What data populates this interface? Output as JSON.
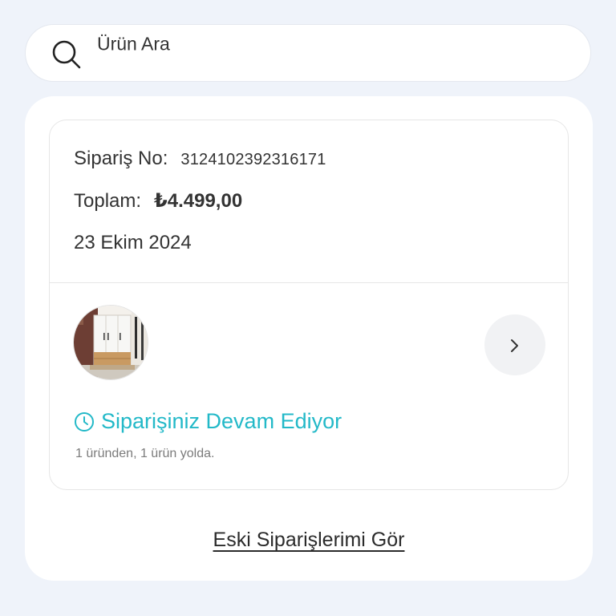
{
  "search": {
    "placeholder": "Ürün Ara",
    "icon": "search-icon"
  },
  "order": {
    "order_no_label": "Sipariş No:",
    "order_no_value": "3124102392316171",
    "total_label": "Toplam:",
    "total_value": "₺4.499,00",
    "date": "23 Ekim 2024",
    "product_image": "wardrobe-product-image",
    "chevron_icon": "chevron-right-icon",
    "status_icon": "clock-icon",
    "status_text": "Siparişiniz Devam Ediyor",
    "status_sub": "1 üründen, 1 ürün yolda."
  },
  "footer": {
    "old_orders_link": "Eski Siparişlerimi Gör"
  },
  "colors": {
    "page_background": "#eff3fa",
    "card_background": "#ffffff",
    "status_accent": "#23b9c8",
    "text_primary": "#2b2b2b",
    "text_secondary": "#7b7b7b",
    "chevron_button_bg": "#f1f2f4"
  }
}
